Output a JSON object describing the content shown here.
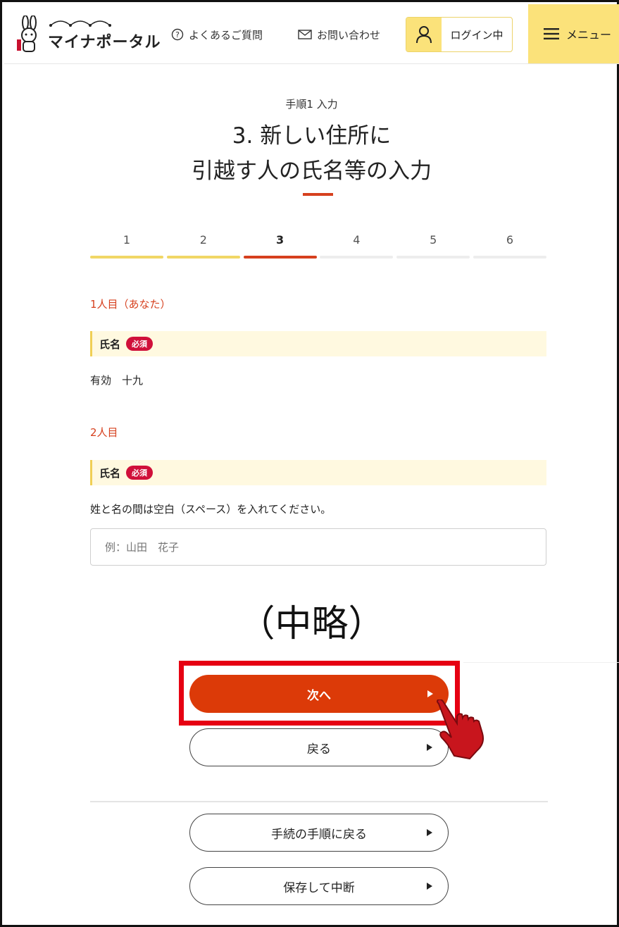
{
  "header": {
    "logo_text": "マイナポータル",
    "faq_label": "よくあるご質問",
    "contact_label": "お問い合わせ",
    "login_label": "ログイン中",
    "menu_label": "メニュー"
  },
  "page": {
    "step_label": "手順1 入力",
    "title_line1": "3. 新しい住所に",
    "title_line2": "引越す人の氏名等の入力"
  },
  "steps": {
    "labels": [
      "1",
      "2",
      "3",
      "4",
      "5",
      "6"
    ],
    "current": 3
  },
  "person1": {
    "heading": "1人目（あなた）",
    "field_label": "氏名",
    "required_badge": "必須",
    "value": "有効　十九"
  },
  "person2": {
    "heading": "2人目",
    "field_label": "氏名",
    "required_badge": "必須",
    "hint": "姓と名の間は空白（スペース）を入れてください。",
    "placeholder": "例：山田　花子"
  },
  "annotation": {
    "omitted": "（中略）"
  },
  "buttons": {
    "next": "次へ",
    "back": "戻る",
    "back_to_steps": "手続の手順に戻る",
    "save_and_suspend": "保存して中断"
  },
  "colors": {
    "accent_orange": "#dc3a08",
    "header_yellow": "#fbe27a",
    "required_red": "#d0103a",
    "highlight_red": "#e60012"
  }
}
